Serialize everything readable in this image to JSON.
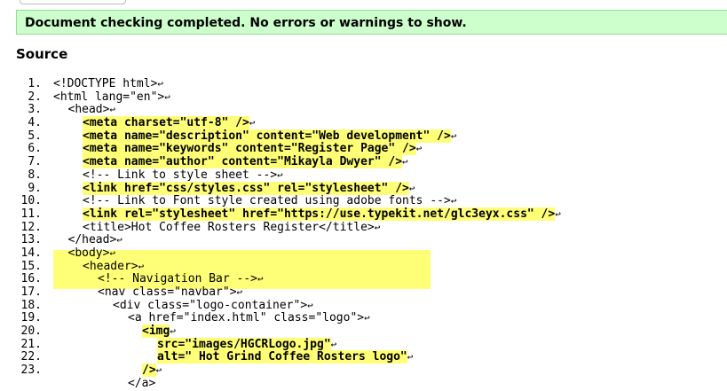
{
  "status": {
    "message": "Document checking completed. No errors or warnings to show."
  },
  "section": {
    "title": "Source"
  },
  "colors": {
    "status_bg": "#ccffcc",
    "highlight": "#ffff77"
  },
  "return_glyph": "↩",
  "lines": [
    {
      "num": "1.",
      "text": "<!DOCTYPE html>",
      "indent": 0,
      "hl": false
    },
    {
      "num": "2.",
      "text": "<html lang=\"en\">",
      "indent": 0,
      "hl": false
    },
    {
      "num": "3.",
      "text": "<head>",
      "indent": 1,
      "hl": false
    },
    {
      "num": "4.",
      "text": "<meta charset=\"utf-8\" />",
      "indent": 2,
      "hl": true
    },
    {
      "num": "5.",
      "text": "<meta name=\"description\" content=\"Web development\" />",
      "indent": 2,
      "hl": true
    },
    {
      "num": "6.",
      "text": "<meta name=\"keywords\" content=\"Register Page\" />",
      "indent": 2,
      "hl": true
    },
    {
      "num": "7.",
      "text": "<meta name=\"author\" content=\"Mikayla Dwyer\" />",
      "indent": 2,
      "hl": true
    },
    {
      "num": "8.",
      "text": "<!-- Link to style sheet -->",
      "indent": 2,
      "hl": false
    },
    {
      "num": "9.",
      "text": "<link href=\"css/styles.css\" rel=\"stylesheet\" />",
      "indent": 2,
      "hl": true
    },
    {
      "num": "10.",
      "text": "<!-- Link to Font style created using adobe fonts -->",
      "indent": 2,
      "hl": false
    },
    {
      "num": "11.",
      "text": "<link rel=\"stylesheet\" href=\"https://use.typekit.net/glc3eyx.css\" />",
      "indent": 2,
      "hl": true
    },
    {
      "num": "12.",
      "text": "<title>Hot Coffee Rosters Register</title>",
      "indent": 2,
      "hl": false
    },
    {
      "num": "13.",
      "text": "</head>",
      "indent": 1,
      "hl": false
    },
    {
      "num": "14.",
      "text": "<body>",
      "indent": 1,
      "hl": false
    },
    {
      "num": "15.",
      "text": "<header>",
      "indent": 2,
      "hl": false
    },
    {
      "num": "16.",
      "text": "<!-- Navigation Bar -->",
      "indent": 3,
      "hl": false
    },
    {
      "num": "17.",
      "text": "<nav class=\"navbar\">",
      "indent": 3,
      "hl": false
    },
    {
      "num": "18.",
      "text": "<div class=\"logo-container\">",
      "indent": 4,
      "hl": false
    },
    {
      "num": "19.",
      "text": "<a href=\"index.html\" class=\"logo\">",
      "indent": 5,
      "hl": false
    },
    {
      "num": "20.",
      "text": "<img",
      "indent": 6,
      "hl": true
    },
    {
      "num": "21.",
      "text": "src=\"images/HGCRLogo.jpg\"",
      "indent": 7,
      "hl": true,
      "block": true
    },
    {
      "num": "22.",
      "text": "alt=\" Hot Grind Coffee Rosters logo\"",
      "indent": 7,
      "hl": true,
      "block": true
    },
    {
      "num": "23.",
      "text": "/>",
      "indent": 6,
      "hl": true,
      "block": true
    },
    {
      "num": "",
      "text": "</a>",
      "indent": 5,
      "hl": false
    }
  ]
}
